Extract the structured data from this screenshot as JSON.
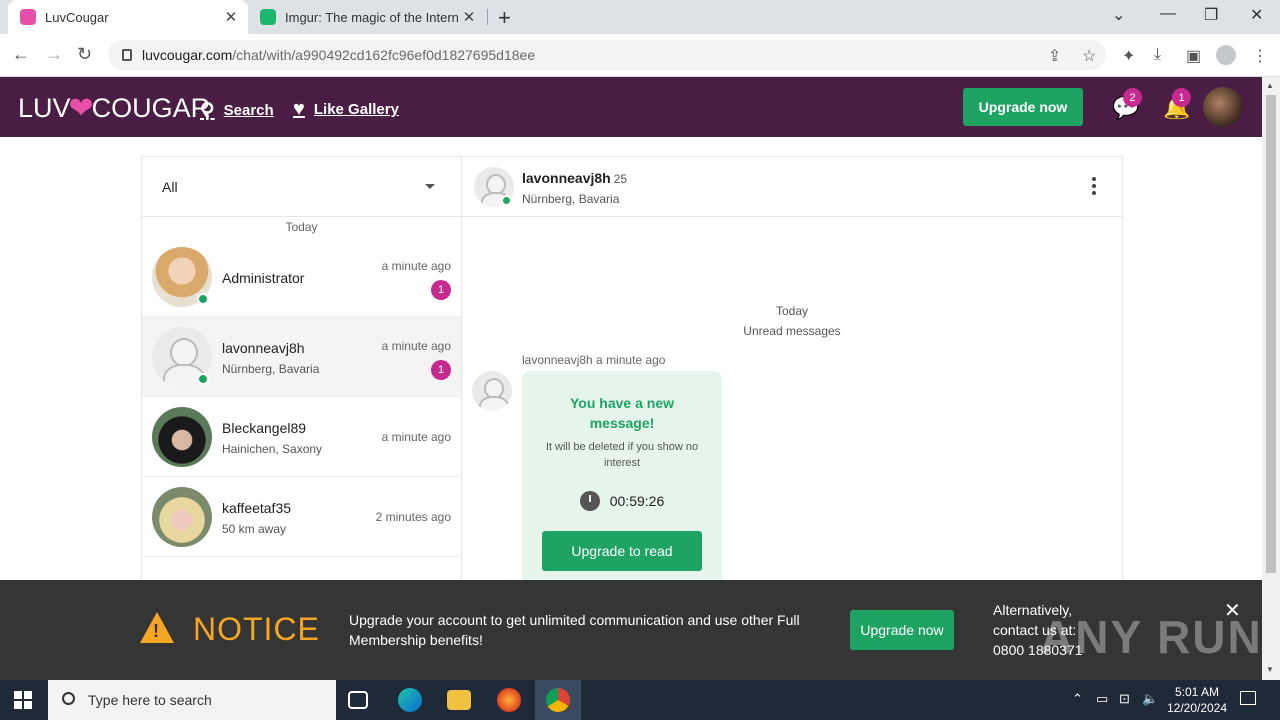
{
  "browser": {
    "tabs": [
      {
        "title": "LuvCougar",
        "close": "✕"
      },
      {
        "title": "Imgur: The magic of the Internet",
        "close": "✕"
      }
    ],
    "new_tab": "+",
    "url_host": "luvcougar.com",
    "url_path": "/chat/with/a990492cd162fc96ef0d1827695d18ee"
  },
  "header": {
    "logo_left": "LUV",
    "logo_right": "COUGAR",
    "search_label": "Search",
    "gallery_label": "Like Gallery",
    "upgrade_label": "Upgrade now",
    "messages_badge": "2",
    "notifications_badge": "1"
  },
  "chat_list": {
    "filter_value": "All",
    "day_label": "Today",
    "conversations": [
      {
        "name": "Administrator",
        "location": "",
        "time": "a minute ago",
        "unread": "1"
      },
      {
        "name": "lavonneavj8h",
        "location": "Nürnberg, Bavaria",
        "time": "a minute ago",
        "unread": "1"
      },
      {
        "name": "Bleckangel89",
        "location": "Hainichen, Saxony",
        "time": "a minute ago",
        "unread": ""
      },
      {
        "name": "kaffeetaf35",
        "location": "50 km away",
        "time": "2 minutes ago",
        "unread": ""
      }
    ]
  },
  "chat": {
    "name": "lavonneavj8h",
    "age": "25",
    "location": "Nürnberg, Bavaria",
    "day_label": "Today",
    "unread_label": "Unread messages",
    "message_meta": "lavonneavj8h a minute ago",
    "message_title": "You have a new message!",
    "message_sub": "It will be deleted if you show no interest",
    "timer": "00:59:26",
    "read_button": "Upgrade to read"
  },
  "notice": {
    "title": "NOTICE",
    "text": "Upgrade your account to get unlimited communication and use other Full Membership benefits!",
    "button": "Upgrade now",
    "alt": "Alternatively, contact us at: 0800 1880371",
    "close": "✕"
  },
  "watermark": "ANY RUN",
  "taskbar": {
    "search_placeholder": "Type here to search",
    "time": "5:01 AM",
    "date": "12/20/2024"
  },
  "colors": {
    "header_bg": "#4a1d44",
    "accent_green": "#1ea362",
    "badge_pink": "#c72a8f",
    "notice_orange": "#f5a623"
  }
}
